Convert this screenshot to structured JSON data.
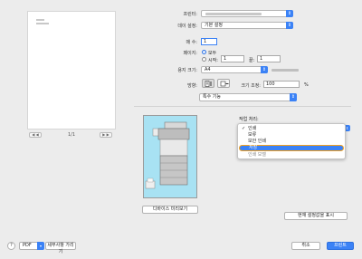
{
  "preview": {
    "page_indicator": "1/1",
    "prev_symbol": "◀ ◀",
    "next_symbol": "▶ ▶"
  },
  "form": {
    "printer_label": "프린터:",
    "presets_label": "데이 설정:",
    "presets_value": "기본 설정",
    "copies_label": "매 수:",
    "copies_value": "1",
    "pages_label": "페이지:",
    "pages_all": "모두",
    "pages_from": "시작:",
    "pages_from_value": "1",
    "pages_to": "끝:",
    "pages_to_value": "1",
    "paper_size_label": "용지 크기:",
    "paper_size_value": "A4",
    "orientation_label": "방향:",
    "scale_label": "크기 조정:",
    "scale_value": "100",
    "scale_unit": "%"
  },
  "section_menu": {
    "value": "특수 기능"
  },
  "job_processing": {
    "label": "작업 처리:",
    "options": [
      {
        "label": "인쇄",
        "checked": true
      },
      {
        "label": "보류",
        "checked": false
      },
      {
        "label": "보안 인쇄",
        "checked": false
      },
      {
        "label": "저장",
        "checked": false,
        "selected": true
      },
      {
        "label": "인쇄 모델",
        "checked": false,
        "dimmed": true
      }
    ]
  },
  "device_preview_button": "디바이스 미리보기",
  "show_current_settings_button": "현재 설정값을 표시",
  "footer": {
    "help": "?",
    "pdf_label": "PDF",
    "hide_details": "세부사항 가리기",
    "cancel": "취소",
    "print": "프린트"
  },
  "colors": {
    "accent": "#3b82f6",
    "focus_ring": "#f4a01c",
    "device_background": "#a8e2f3"
  }
}
